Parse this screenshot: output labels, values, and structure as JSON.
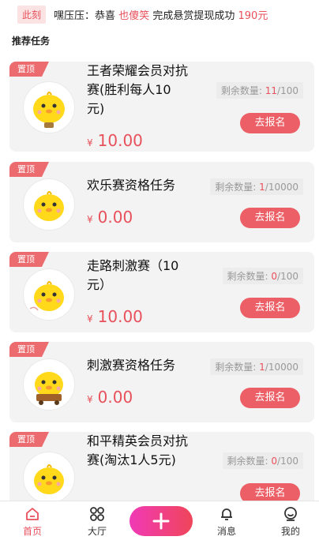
{
  "ticker": {
    "tag": "此刻",
    "user": "嘿压压",
    "congrats": "：恭喜",
    "highlight_user": "也傻笑",
    "action": "完成悬赏提现成功",
    "amount": "190元"
  },
  "section_title": "推荐任务",
  "pin_label": "置顶",
  "remain_label": "剩余数量:",
  "currency": "¥",
  "join_label": "去报名",
  "tasks": [
    {
      "title": "王者荣耀会员对抗赛(胜利每人10元)",
      "price": "10.00",
      "remain": "11",
      "total": "/100"
    },
    {
      "title": "欢乐赛资格任务",
      "price": "0.00",
      "remain": "1",
      "total": "/10000"
    },
    {
      "title": "走路刺激赛（10元）",
      "price": "10.00",
      "remain": "0",
      "total": "/100"
    },
    {
      "title": "刺激赛资格任务",
      "price": "0.00",
      "remain": "1",
      "total": "/10000"
    },
    {
      "title": "和平精英会员对抗赛(淘汰1人5元)",
      "price": "",
      "remain": "0",
      "total": "/100"
    }
  ],
  "tabs": [
    {
      "label": "首页",
      "icon": "home-icon"
    },
    {
      "label": "大厅",
      "icon": "grid-icon"
    },
    {
      "label": "消息",
      "icon": "bell-icon"
    },
    {
      "label": "我的",
      "icon": "user-icon"
    }
  ],
  "colors": {
    "accent": "#e8505b",
    "plus_start": "#f03ab6",
    "plus_end": "#f0455a"
  }
}
